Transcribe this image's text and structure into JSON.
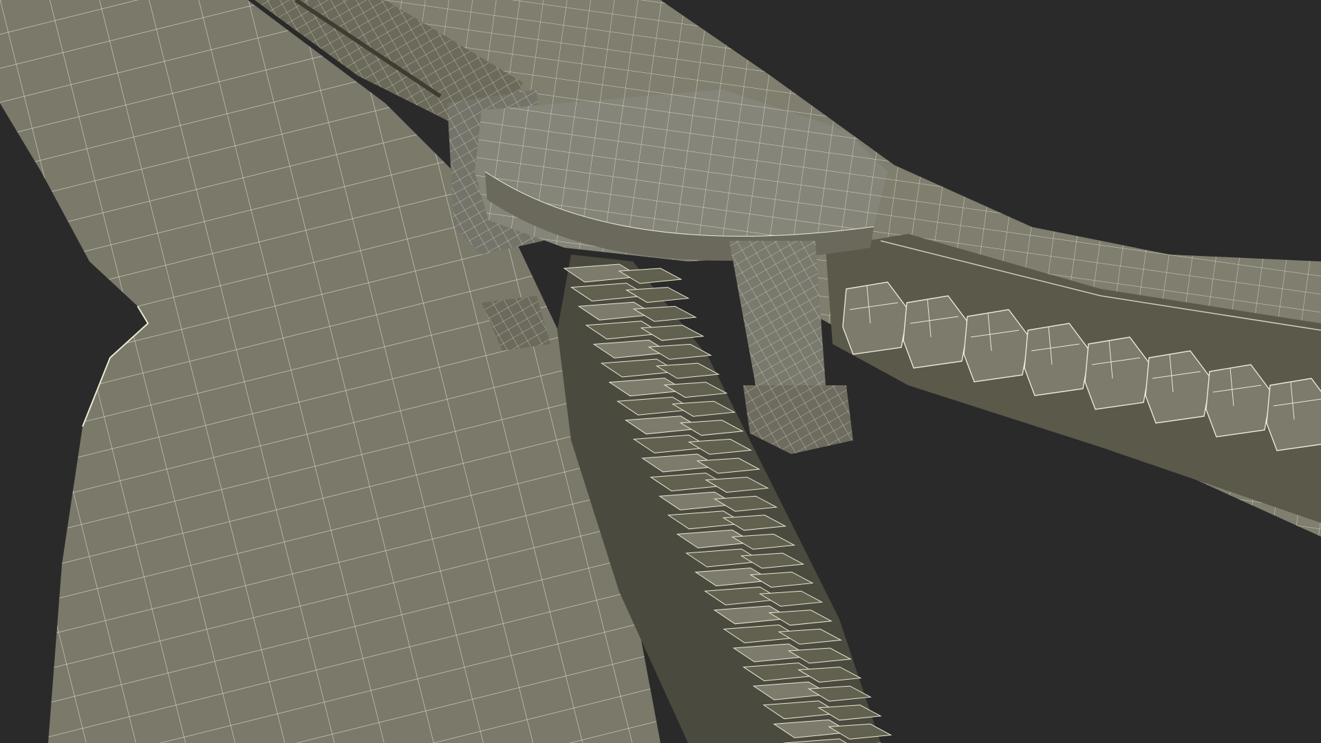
{
  "scene": {
    "subject": "wireframe-zipper-render",
    "colors": {
      "background": "#2a2a2a",
      "surface": "#7c7b6c",
      "surface_light": "#8d8c7d",
      "surface_dark": "#62614f",
      "shadow": "#3e3d33",
      "wire": "#ecead8"
    }
  }
}
